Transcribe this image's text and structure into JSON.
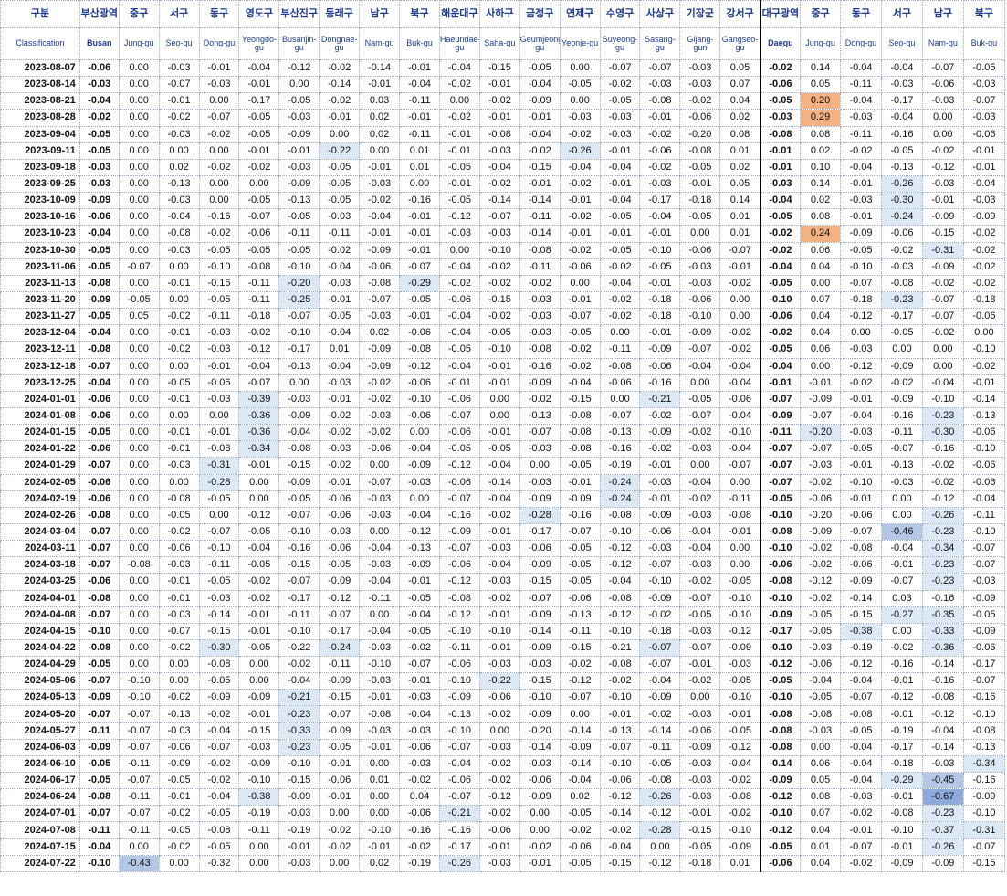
{
  "header": {
    "ko": [
      "구분",
      "부산광역시",
      "중구",
      "서구",
      "동구",
      "영도구",
      "부산진구",
      "동래구",
      "남구",
      "북구",
      "해운대구",
      "사하구",
      "금정구",
      "연제구",
      "수영구",
      "사상구",
      "기장군",
      "강서구",
      "대구광역시",
      "중구",
      "서구",
      "동구",
      "남구",
      "북구"
    ],
    "en": [
      "Classification",
      "Busan",
      "Jung-gu",
      "Seo-gu",
      "Dong-gu",
      "Yeongdo-gu",
      "Busanjin-gu",
      "Dongnae-gu",
      "Nam-gu",
      "Buk-gu",
      "Haeundae-gu",
      "Saha-gu",
      "Geumjeong-gu",
      "Yeonje-gu",
      "Suyeong-gu",
      "Sasang-gu",
      "Gijang-gun",
      "Gangseo-gu",
      "Daegu",
      "Jung-gu",
      "Dong-gu",
      "Seo-gu",
      "Nam-gu",
      "Buk-gu"
    ]
  },
  "header_ko_display": [
    "구분",
    "부산광역",
    "중구",
    "서구",
    "동구",
    "영도구",
    "부산진구",
    "동래구",
    "남구",
    "북구",
    "해운대구",
    "사하구",
    "금정구",
    "연제구",
    "수영구",
    "사상구",
    "기장군",
    "강서구",
    "대구광역",
    "중구",
    "동구",
    "서구",
    "남구",
    "북구"
  ],
  "header_en_display": [
    "Classification",
    "Busan",
    "Jung-gu",
    "Seo-gu",
    "Dong-gu",
    "Yeongdo-gu",
    "Busanjin-gu",
    "Dongnae-gu",
    "Nam-gu",
    "Buk-gu",
    "Haeundae-gu",
    "Saha-gu",
    "Geumjeong-gu",
    "Yeonje-gu",
    "Suyeong-gu",
    "Sasang-gu",
    "Gijang-gun",
    "Gangseo-gu",
    "Daegu",
    "Jung-gu",
    "Dong-gu",
    "Seo-gu",
    "Nam-gu",
    "Buk-gu"
  ],
  "rows": [
    [
      "2023-08-07",
      "-0.06",
      "0.00",
      "-0.03",
      "-0.01",
      "-0.04",
      "-0.12",
      "-0.02",
      "-0.14",
      "-0.01",
      "-0.04",
      "-0.15",
      "-0.05",
      "0.00",
      "-0.07",
      "-0.07",
      "-0.03",
      "0.05",
      "-0.02",
      "0.14",
      "-0.04",
      "-0.04",
      "-0.07",
      "-0.05"
    ],
    [
      "2023-08-14",
      "-0.03",
      "0.00",
      "-0.07",
      "-0.03",
      "-0.01",
      "0.00",
      "-0.14",
      "-0.01",
      "-0.04",
      "-0.02",
      "-0.01",
      "-0.04",
      "-0.05",
      "-0.02",
      "-0.03",
      "-0.03",
      "0.07",
      "-0.06",
      "0.05",
      "-0.11",
      "-0.03",
      "-0.06",
      "-0.03"
    ],
    [
      "2023-08-21",
      "-0.04",
      "0.00",
      "-0.01",
      "0.00",
      "-0.17",
      "-0.05",
      "-0.02",
      "0.03",
      "-0.11",
      "0.00",
      "-0.02",
      "-0.09",
      "0.00",
      "-0.05",
      "-0.08",
      "-0.02",
      "0.04",
      "-0.05",
      "0.20",
      "-0.04",
      "-0.17",
      "-0.03",
      "-0.07"
    ],
    [
      "2023-08-28",
      "-0.02",
      "0.00",
      "-0.02",
      "-0.07",
      "-0.05",
      "-0.03",
      "-0.01",
      "0.02",
      "-0.01",
      "-0.02",
      "-0.01",
      "-0.01",
      "-0.03",
      "-0.03",
      "-0.01",
      "-0.06",
      "0.02",
      "-0.03",
      "0.29",
      "-0.03",
      "-0.04",
      "0.00",
      "-0.03"
    ],
    [
      "2023-09-04",
      "-0.05",
      "0.00",
      "-0.03",
      "-0.02",
      "-0.05",
      "-0.09",
      "0.00",
      "0.02",
      "-0.11",
      "-0.01",
      "-0.08",
      "-0.04",
      "-0.02",
      "-0.03",
      "-0.02",
      "-0.20",
      "0.08",
      "-0.08",
      "0.08",
      "-0.11",
      "-0.16",
      "0.00",
      "-0.06"
    ],
    [
      "2023-09-11",
      "-0.05",
      "0.00",
      "0.00",
      "0.00",
      "-0.01",
      "-0.01",
      "-0.22",
      "0.00",
      "0.01",
      "-0.01",
      "-0.03",
      "-0.02",
      "-0.26",
      "-0.01",
      "-0.06",
      "-0.08",
      "0.01",
      "-0.01",
      "0.02",
      "-0.02",
      "-0.05",
      "-0.02",
      "-0.01"
    ],
    [
      "2023-09-18",
      "-0.03",
      "0.00",
      "0.02",
      "-0.02",
      "-0.02",
      "-0.03",
      "-0.05",
      "-0.01",
      "0.01",
      "-0.05",
      "-0.04",
      "-0.15",
      "-0.04",
      "-0.04",
      "-0.02",
      "-0.05",
      "0.02",
      "-0.01",
      "0.10",
      "-0.04",
      "-0.13",
      "-0.12",
      "-0.01"
    ],
    [
      "2023-09-25",
      "-0.03",
      "0.00",
      "-0.13",
      "0.00",
      "0.00",
      "-0.09",
      "-0.05",
      "-0.03",
      "0.00",
      "-0.01",
      "-0.02",
      "-0.01",
      "-0.02",
      "-0.01",
      "-0.03",
      "-0.01",
      "0.05",
      "-0.03",
      "0.14",
      "-0.01",
      "-0.26",
      "-0.03",
      "-0.04"
    ],
    [
      "2023-10-09",
      "-0.09",
      "0.00",
      "-0.03",
      "0.00",
      "-0.05",
      "-0.13",
      "-0.05",
      "-0.02",
      "-0.16",
      "-0.05",
      "-0.14",
      "-0.14",
      "-0.01",
      "-0.04",
      "-0.17",
      "-0.18",
      "0.14",
      "-0.04",
      "0.02",
      "-0.03",
      "-0.30",
      "-0.01",
      "-0.03"
    ],
    [
      "2023-10-16",
      "-0.06",
      "0.00",
      "-0.04",
      "-0.16",
      "-0.07",
      "-0.05",
      "-0.03",
      "-0.04",
      "-0.01",
      "-0.12",
      "-0.07",
      "-0.11",
      "-0.02",
      "-0.05",
      "-0.04",
      "-0.05",
      "0.01",
      "-0.05",
      "0.08",
      "-0.01",
      "-0.24",
      "-0.09",
      "-0.09"
    ],
    [
      "2023-10-23",
      "-0.04",
      "0.00",
      "-0.08",
      "-0.02",
      "-0.06",
      "-0.11",
      "-0.11",
      "-0.01",
      "-0.01",
      "-0.03",
      "-0.03",
      "-0.14",
      "-0.01",
      "-0.01",
      "-0.01",
      "0.00",
      "0.01",
      "-0.02",
      "0.24",
      "-0.09",
      "-0.06",
      "-0.15",
      "-0.02"
    ],
    [
      "2023-10-30",
      "-0.05",
      "0.00",
      "-0.03",
      "-0.05",
      "-0.05",
      "-0.05",
      "-0.02",
      "-0.09",
      "-0.01",
      "0.00",
      "-0.10",
      "-0.08",
      "-0.02",
      "-0.05",
      "-0.10",
      "-0.06",
      "-0.07",
      "-0.02",
      "0.06",
      "-0.05",
      "-0.02",
      "-0.31",
      "-0.02"
    ],
    [
      "2023-11-06",
      "-0.05",
      "-0.07",
      "0.00",
      "-0.10",
      "-0.08",
      "-0.10",
      "-0.04",
      "-0.06",
      "-0.07",
      "-0.04",
      "-0.02",
      "-0.11",
      "-0.06",
      "-0.02",
      "-0.05",
      "-0.03",
      "-0.01",
      "-0.04",
      "0.04",
      "-0.10",
      "-0.03",
      "-0.09",
      "-0.02"
    ],
    [
      "2023-11-13",
      "-0.08",
      "0.00",
      "-0.01",
      "-0.16",
      "-0.11",
      "-0.20",
      "-0.03",
      "-0.08",
      "-0.29",
      "-0.02",
      "-0.02",
      "-0.02",
      "0.00",
      "-0.04",
      "-0.01",
      "-0.03",
      "-0.02",
      "-0.05",
      "0.00",
      "-0.07",
      "-0.08",
      "-0.02",
      "-0.02"
    ],
    [
      "2023-11-20",
      "-0.09",
      "-0.05",
      "0.00",
      "-0.05",
      "-0.11",
      "-0.25",
      "-0.01",
      "-0.07",
      "-0.05",
      "-0.06",
      "-0.15",
      "-0.03",
      "-0.01",
      "-0.02",
      "-0.18",
      "-0.06",
      "0.00",
      "-0.10",
      "0.07",
      "-0.18",
      "-0.23",
      "-0.07",
      "-0.18"
    ],
    [
      "2023-11-27",
      "-0.05",
      "0.05",
      "-0.02",
      "-0.11",
      "-0.18",
      "-0.07",
      "-0.05",
      "-0.03",
      "-0.01",
      "-0.04",
      "-0.02",
      "-0.03",
      "-0.07",
      "-0.02",
      "-0.18",
      "-0.10",
      "0.00",
      "-0.06",
      "0.04",
      "-0.12",
      "-0.17",
      "-0.07",
      "-0.06"
    ],
    [
      "2023-12-04",
      "-0.04",
      "0.00",
      "-0.01",
      "-0.03",
      "-0.02",
      "-0.10",
      "-0.04",
      "0.02",
      "-0.06",
      "-0.04",
      "-0.05",
      "-0.03",
      "-0.05",
      "0.00",
      "-0.01",
      "-0.09",
      "-0.02",
      "-0.02",
      "0.04",
      "0.00",
      "-0.05",
      "-0.02",
      "0.00"
    ],
    [
      "2023-12-11",
      "-0.08",
      "0.00",
      "-0.02",
      "-0.03",
      "-0.12",
      "-0.17",
      "0.01",
      "-0.09",
      "-0.08",
      "-0.05",
      "-0.10",
      "-0.08",
      "-0.02",
      "-0.11",
      "-0.09",
      "-0.07",
      "-0.02",
      "-0.05",
      "0.06",
      "-0.03",
      "0.00",
      "0.00",
      "-0.10"
    ],
    [
      "2023-12-18",
      "-0.07",
      "0.00",
      "0.00",
      "-0.01",
      "-0.04",
      "-0.13",
      "-0.04",
      "-0.09",
      "-0.12",
      "-0.04",
      "-0.01",
      "-0.16",
      "-0.02",
      "-0.08",
      "-0.06",
      "-0.04",
      "-0.04",
      "-0.04",
      "0.00",
      "-0.12",
      "-0.09",
      "0.00",
      "-0.02"
    ],
    [
      "2023-12-25",
      "-0.04",
      "0.00",
      "-0.05",
      "-0.06",
      "-0.07",
      "0.00",
      "-0.03",
      "-0.02",
      "-0.06",
      "-0.01",
      "-0.01",
      "-0.09",
      "-0.04",
      "-0.06",
      "-0.16",
      "0.00",
      "-0.04",
      "-0.01",
      "-0.01",
      "-0.02",
      "-0.02",
      "-0.04",
      "-0.01"
    ],
    [
      "2024-01-01",
      "-0.06",
      "0.00",
      "-0.01",
      "-0.03",
      "-0.39",
      "-0.03",
      "-0.01",
      "-0.02",
      "-0.10",
      "-0.06",
      "0.00",
      "-0.02",
      "-0.15",
      "0.00",
      "-0.21",
      "-0.05",
      "-0.06",
      "-0.07",
      "-0.09",
      "-0.01",
      "-0.09",
      "-0.10",
      "-0.14"
    ],
    [
      "2024-01-08",
      "-0.06",
      "0.00",
      "0.00",
      "0.00",
      "-0.36",
      "-0.09",
      "-0.02",
      "-0.03",
      "-0.06",
      "-0.07",
      "0.00",
      "-0.13",
      "-0.08",
      "-0.07",
      "-0.02",
      "-0.07",
      "-0.04",
      "-0.09",
      "-0.07",
      "-0.04",
      "-0.16",
      "-0.23",
      "-0.13"
    ],
    [
      "2024-01-15",
      "-0.05",
      "0.00",
      "-0.01",
      "-0.01",
      "-0.36",
      "-0.04",
      "-0.02",
      "-0.02",
      "0.00",
      "-0.06",
      "-0.01",
      "-0.07",
      "-0.08",
      "-0.13",
      "-0.09",
      "-0.02",
      "-0.10",
      "-0.11",
      "-0.20",
      "-0.03",
      "-0.11",
      "-0.30",
      "-0.06"
    ],
    [
      "2024-01-22",
      "-0.06",
      "0.00",
      "-0.01",
      "-0.08",
      "-0.34",
      "-0.08",
      "-0.03",
      "-0.06",
      "-0.04",
      "-0.05",
      "-0.05",
      "-0.03",
      "-0.08",
      "-0.16",
      "-0.02",
      "-0.03",
      "-0.04",
      "-0.07",
      "-0.07",
      "-0.05",
      "-0.07",
      "-0.16",
      "-0.10"
    ],
    [
      "2024-01-29",
      "-0.07",
      "0.00",
      "-0.03",
      "-0.31",
      "-0.01",
      "-0.15",
      "-0.02",
      "0.00",
      "-0.09",
      "-0.12",
      "-0.04",
      "0.00",
      "-0.05",
      "-0.19",
      "-0.01",
      "0.00",
      "-0.07",
      "-0.07",
      "-0.03",
      "-0.01",
      "-0.13",
      "-0.02",
      "-0.06"
    ],
    [
      "2024-02-05",
      "-0.06",
      "0.00",
      "0.00",
      "-0.28",
      "0.00",
      "-0.09",
      "-0.01",
      "-0.07",
      "-0.03",
      "-0.06",
      "-0.14",
      "-0.03",
      "-0.01",
      "-0.24",
      "-0.03",
      "-0.04",
      "0.00",
      "-0.07",
      "-0.02",
      "-0.10",
      "-0.03",
      "-0.02",
      "-0.06"
    ],
    [
      "2024-02-19",
      "-0.06",
      "0.00",
      "-0.08",
      "-0.05",
      "0.00",
      "-0.05",
      "-0.06",
      "-0.03",
      "0.00",
      "-0.07",
      "-0.04",
      "-0.09",
      "-0.09",
      "-0.24",
      "-0.01",
      "-0.02",
      "-0.11",
      "-0.05",
      "-0.06",
      "-0.01",
      "0.00",
      "-0.12",
      "-0.04"
    ],
    [
      "2024-02-26",
      "-0.08",
      "0.00",
      "-0.05",
      "0.00",
      "-0.12",
      "-0.07",
      "-0.06",
      "-0.03",
      "-0.04",
      "-0.16",
      "-0.02",
      "-0.28",
      "-0.16",
      "-0.08",
      "-0.09",
      "-0.03",
      "-0.08",
      "-0.10",
      "-0.20",
      "-0.06",
      "0.00",
      "-0.26",
      "-0.11"
    ],
    [
      "2024-03-04",
      "-0.07",
      "0.00",
      "-0.02",
      "-0.07",
      "-0.05",
      "-0.10",
      "-0.03",
      "0.00",
      "-0.12",
      "-0.09",
      "-0.01",
      "-0.17",
      "-0.07",
      "-0.10",
      "-0.06",
      "-0.04",
      "-0.01",
      "-0.08",
      "-0.09",
      "-0.07",
      "-0.46",
      "-0.23",
      "-0.10"
    ],
    [
      "2024-03-11",
      "-0.07",
      "0.00",
      "-0.06",
      "-0.10",
      "-0.04",
      "-0.16",
      "-0.06",
      "-0.04",
      "-0.13",
      "-0.07",
      "-0.03",
      "-0.06",
      "-0.05",
      "-0.12",
      "-0.03",
      "-0.04",
      "0.00",
      "-0.10",
      "-0.02",
      "-0.08",
      "-0.04",
      "-0.34",
      "-0.07"
    ],
    [
      "2024-03-18",
      "-0.07",
      "-0.08",
      "-0.03",
      "-0.11",
      "-0.05",
      "-0.15",
      "-0.05",
      "-0.03",
      "-0.09",
      "-0.06",
      "-0.04",
      "-0.09",
      "-0.05",
      "-0.12",
      "-0.07",
      "-0.03",
      "0.00",
      "-0.06",
      "-0.02",
      "-0.06",
      "-0.01",
      "-0.23",
      "-0.07"
    ],
    [
      "2024-03-25",
      "-0.06",
      "0.00",
      "-0.01",
      "-0.05",
      "-0.02",
      "-0.07",
      "-0.09",
      "-0.04",
      "-0.01",
      "-0.12",
      "-0.03",
      "-0.15",
      "-0.05",
      "-0.04",
      "-0.10",
      "-0.02",
      "-0.05",
      "-0.08",
      "-0.12",
      "-0.09",
      "-0.07",
      "-0.23",
      "-0.03"
    ],
    [
      "2024-04-01",
      "-0.08",
      "0.00",
      "-0.01",
      "-0.03",
      "-0.02",
      "-0.17",
      "-0.12",
      "-0.11",
      "-0.05",
      "-0.08",
      "-0.02",
      "-0.07",
      "-0.06",
      "-0.08",
      "-0.09",
      "-0.07",
      "-0.10",
      "-0.10",
      "-0.02",
      "-0.14",
      "0.03",
      "-0.16",
      "-0.09"
    ],
    [
      "2024-04-08",
      "-0.07",
      "0.00",
      "-0.03",
      "-0.14",
      "-0.01",
      "-0.11",
      "-0.07",
      "0.00",
      "-0.04",
      "-0.12",
      "-0.01",
      "-0.09",
      "-0.13",
      "-0.12",
      "-0.02",
      "-0.05",
      "-0.10",
      "-0.09",
      "-0.05",
      "-0.15",
      "-0.27",
      "-0.35",
      "-0.05"
    ],
    [
      "2024-04-15",
      "-0.10",
      "0.00",
      "-0.07",
      "-0.15",
      "-0.01",
      "-0.10",
      "-0.17",
      "-0.04",
      "-0.05",
      "-0.10",
      "-0.10",
      "-0.14",
      "-0.11",
      "-0.10",
      "-0.18",
      "-0.03",
      "-0.12",
      "-0.17",
      "-0.05",
      "-0.38",
      "0.00",
      "-0.33",
      "-0.09"
    ],
    [
      "2024-04-22",
      "-0.08",
      "0.00",
      "-0.02",
      "-0.30",
      "-0.05",
      "-0.22",
      "-0.24",
      "-0.03",
      "-0.02",
      "-0.11",
      "-0.01",
      "-0.09",
      "-0.15",
      "-0.21",
      "-0.07",
      "-0.07",
      "-0.09",
      "-0.10",
      "-0.03",
      "-0.19",
      "-0.02",
      "-0.36",
      "-0.06"
    ],
    [
      "2024-04-29",
      "-0.05",
      "0.00",
      "0.00",
      "-0.08",
      "0.00",
      "-0.02",
      "-0.11",
      "-0.10",
      "-0.07",
      "-0.06",
      "-0.03",
      "-0.03",
      "-0.02",
      "-0.08",
      "-0.07",
      "-0.01",
      "-0.03",
      "-0.12",
      "-0.06",
      "-0.12",
      "-0.16",
      "-0.14",
      "-0.17"
    ],
    [
      "2024-05-06",
      "-0.07",
      "-0.10",
      "0.00",
      "-0.05",
      "0.00",
      "-0.04",
      "-0.09",
      "-0.03",
      "-0.01",
      "-0.10",
      "-0.22",
      "-0.15",
      "-0.12",
      "-0.02",
      "-0.04",
      "-0.02",
      "-0.05",
      "-0.05",
      "-0.04",
      "-0.04",
      "-0.01",
      "-0.16",
      "-0.07"
    ],
    [
      "2024-05-13",
      "-0.09",
      "-0.10",
      "-0.02",
      "-0.09",
      "-0.09",
      "-0.21",
      "-0.15",
      "-0.01",
      "-0.03",
      "-0.09",
      "-0.06",
      "-0.10",
      "-0.07",
      "-0.10",
      "-0.09",
      "0.00",
      "-0.10",
      "-0.10",
      "-0.05",
      "-0.07",
      "-0.12",
      "-0.08",
      "-0.16"
    ],
    [
      "2024-05-20",
      "-0.07",
      "-0.07",
      "-0.13",
      "-0.02",
      "-0.01",
      "-0.23",
      "-0.07",
      "-0.08",
      "-0.04",
      "-0.13",
      "-0.02",
      "-0.09",
      "0.00",
      "-0.01",
      "-0.02",
      "-0.03",
      "-0.01",
      "-0.08",
      "-0.08",
      "-0.08",
      "-0.01",
      "-0.12",
      "-0.10"
    ],
    [
      "2024-05-27",
      "-0.11",
      "-0.07",
      "-0.03",
      "-0.04",
      "-0.15",
      "-0.33",
      "-0.09",
      "-0.03",
      "-0.03",
      "-0.10",
      "0.00",
      "-0.20",
      "-0.14",
      "-0.13",
      "-0.14",
      "-0.06",
      "-0.05",
      "-0.08",
      "-0.03",
      "-0.05",
      "-0.19",
      "-0.04",
      "-0.08"
    ],
    [
      "2024-06-03",
      "-0.09",
      "-0.07",
      "-0.06",
      "-0.07",
      "-0.03",
      "-0.23",
      "-0.05",
      "-0.01",
      "-0.06",
      "-0.07",
      "-0.03",
      "-0.14",
      "-0.09",
      "-0.07",
      "-0.11",
      "-0.09",
      "-0.12",
      "-0.08",
      "0.00",
      "-0.04",
      "-0.17",
      "-0.14",
      "-0.13"
    ],
    [
      "2024-06-10",
      "-0.05",
      "-0.11",
      "-0.09",
      "-0.02",
      "-0.09",
      "-0.10",
      "-0.01",
      "0.00",
      "-0.03",
      "-0.04",
      "-0.02",
      "-0.03",
      "-0.14",
      "-0.10",
      "-0.05",
      "-0.03",
      "-0.04",
      "-0.14",
      "0.06",
      "-0.04",
      "-0.18",
      "-0.03",
      "-0.34"
    ],
    [
      "2024-06-17",
      "-0.05",
      "-0.07",
      "-0.05",
      "-0.02",
      "-0.10",
      "-0.15",
      "-0.06",
      "0.01",
      "-0.02",
      "-0.06",
      "-0.02",
      "-0.06",
      "-0.04",
      "-0.06",
      "-0.08",
      "-0.03",
      "-0.02",
      "-0.09",
      "0.05",
      "-0.04",
      "-0.29",
      "-0.45",
      "-0.16"
    ],
    [
      "2024-06-24",
      "-0.08",
      "-0.11",
      "-0.01",
      "-0.04",
      "-0.38",
      "-0.09",
      "-0.01",
      "0.00",
      "0.04",
      "-0.07",
      "-0.12",
      "-0.09",
      "0.02",
      "-0.12",
      "-0.26",
      "-0.03",
      "-0.08",
      "-0.12",
      "0.08",
      "-0.03",
      "-0.01",
      "-0.67",
      "-0.09"
    ],
    [
      "2024-07-01",
      "-0.07",
      "-0.07",
      "-0.02",
      "-0.05",
      "-0.19",
      "-0.03",
      "0.00",
      "0.00",
      "-0.06",
      "-0.21",
      "-0.02",
      "0.00",
      "-0.05",
      "-0.14",
      "-0.12",
      "-0.01",
      "-0.02",
      "-0.10",
      "0.07",
      "-0.02",
      "-0.08",
      "-0.23",
      "-0.10"
    ],
    [
      "2024-07-08",
      "-0.11",
      "-0.11",
      "-0.05",
      "-0.08",
      "-0.11",
      "-0.19",
      "-0.02",
      "-0.10",
      "-0.16",
      "-0.16",
      "-0.06",
      "0.00",
      "-0.02",
      "-0.02",
      "-0.28",
      "-0.15",
      "-0.10",
      "-0.12",
      "0.04",
      "-0.01",
      "-0.10",
      "-0.37",
      "-0.31"
    ],
    [
      "2024-07-15",
      "-0.04",
      "0.00",
      "-0.02",
      "-0.05",
      "0.00",
      "-0.01",
      "-0.02",
      "-0.01",
      "-0.02",
      "-0.17",
      "-0.01",
      "-0.02",
      "-0.06",
      "-0.04",
      "0.00",
      "-0.05",
      "-0.09",
      "-0.05",
      "0.01",
      "-0.07",
      "-0.01",
      "-0.26",
      "-0.07"
    ],
    [
      "2024-07-22",
      "-0.10",
      "-0.43",
      "0.00",
      "-0.32",
      "0.00",
      "-0.03",
      "0.00",
      "0.02",
      "-0.19",
      "-0.26",
      "-0.03",
      "-0.01",
      "-0.05",
      "-0.15",
      "-0.12",
      "-0.18",
      "0.01",
      "-0.06",
      "0.04",
      "-0.02",
      "-0.09",
      "-0.09",
      "-0.15"
    ]
  ],
  "highlight_colors": {
    "light": "#dce9f5",
    "mid": "#b4c7e7",
    "dark": "#8ea9db",
    "orange": "#f4b183"
  }
}
